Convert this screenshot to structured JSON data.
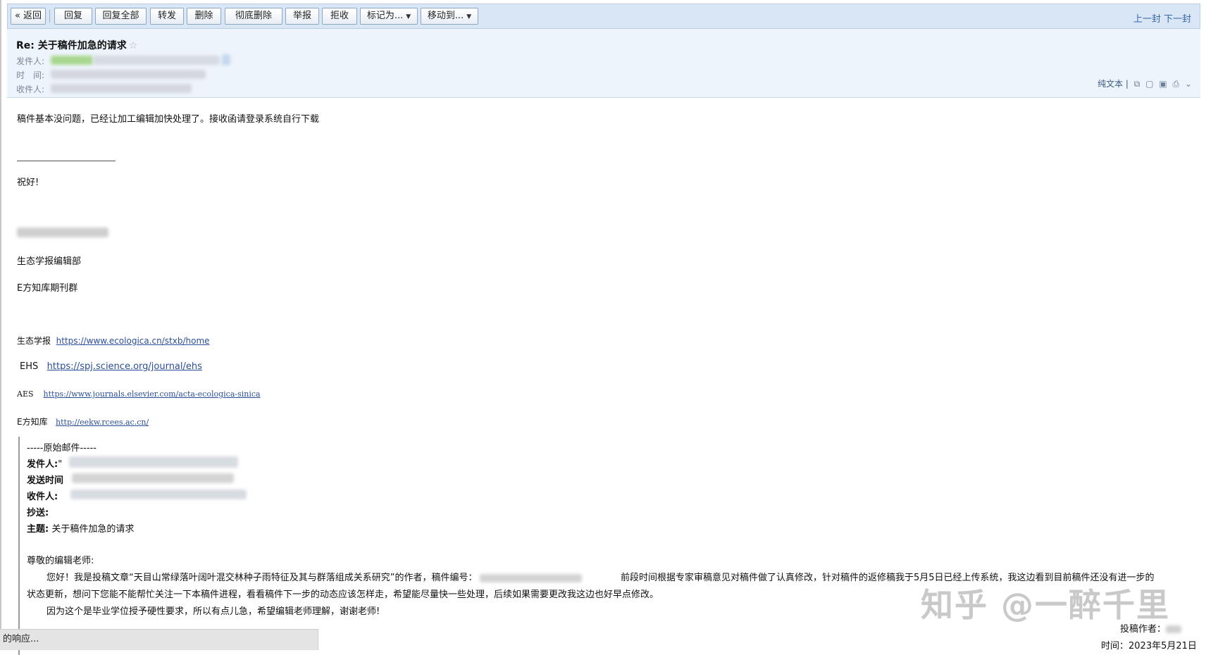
{
  "toolbar": {
    "back": "« 返回",
    "reply": "回复",
    "reply_all": "回复全部",
    "forward": "转发",
    "delete": "删除",
    "delete_permanently": "彻底删除",
    "report": "举报",
    "reject": "拒收",
    "mark_as": "标记为...",
    "move_to": "移动到...",
    "prev": "上一封",
    "next": "下一封"
  },
  "header": {
    "subject": "Re: 关于稿件加急的请求",
    "star": "☆",
    "from_label": "发件人:",
    "time_label": "时　间:",
    "to_label": "收件人:",
    "plain_text": "纯文本"
  },
  "body": {
    "line1": "稿件基本没问题，已经让加工编辑加快处理了。接收函请登录系统自行下载",
    "greeting": "祝好!",
    "dept": "生态学报编辑部",
    "group": "E方知库期刊群",
    "links": [
      {
        "label": "生态学报",
        "url": "https://www.ecologica.cn/stxb/home"
      },
      {
        "label": "EHS",
        "url": "https://spj.science.org/journal/ehs"
      },
      {
        "label": "AES",
        "url": "https://www.journals.elsevier.com/acta-ecologica-sinica"
      },
      {
        "label": "E方知库",
        "url": "http://eekw.rcees.ac.cn/"
      }
    ]
  },
  "quote": {
    "title": "-----原始邮件-----",
    "from_label": "发件人:",
    "from_value": "\"",
    "sent_label": "发送时间",
    "to_label": "收件人:",
    "cc_label": "抄送:",
    "subject_label": "主题:",
    "subject_value": "关于稿件加急的请求",
    "salutation": "尊敬的编辑老师:",
    "para1_a": "您好！我是投稿文章“天目山常绿落叶阔叶混交林种子雨特征及其与群落组成关系研究”的作者，稿件编号：",
    "para1_b": "前段时间根据专家审稿意见对稿件做了认真修改，针对稿件的返修稿我于5月5日已经上传系统，我这边看到目前稿件还没有进一步的",
    "para1_c": "状态更新，想问下您能不能帮忙关注一下本稿件进程，看看稿件下一步的动态应该怎样走，希望能尽量快一些处理，后续如果需要更改我这边也好早点修改。",
    "para2": "因为这个是毕业学位授予硬性要求，所以有点儿急，希望编辑老师理解，谢谢老师!",
    "author_label": "投稿作者：",
    "time": "时间：2023年5月21日"
  },
  "watermark": "知乎 @一醉千里",
  "status": "的响应..."
}
